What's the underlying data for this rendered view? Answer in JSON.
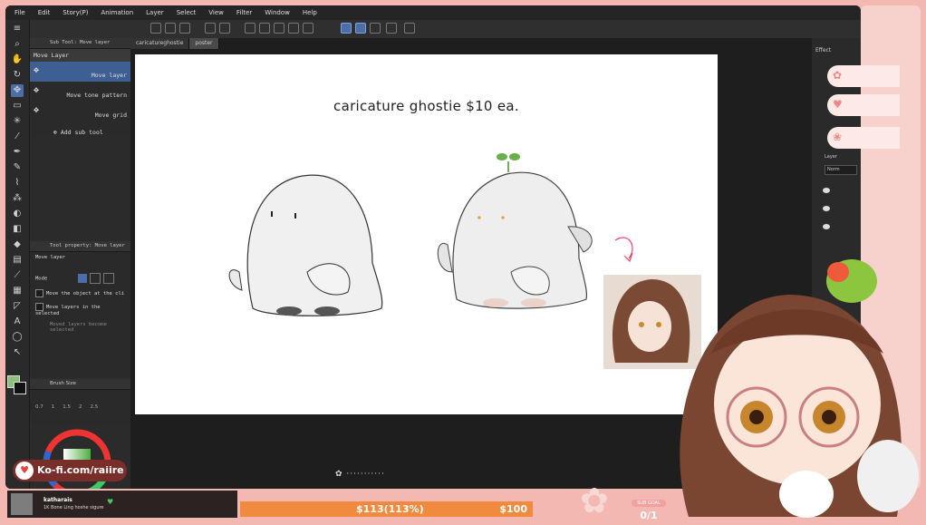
{
  "menu": [
    "File",
    "Edit",
    "Story(P)",
    "Animation",
    "Layer",
    "Select",
    "View",
    "Filter",
    "Window",
    "Help"
  ],
  "tabs": [
    "caricatureghostie",
    "poster"
  ],
  "subtool_panel": {
    "title": "Sub Tool: Move layer",
    "header": "Move Layer",
    "items": [
      {
        "label": "Move layer"
      },
      {
        "label": "Move tone pattern"
      },
      {
        "label": "Move grid"
      }
    ],
    "add": "Add sub tool"
  },
  "tool_property": {
    "title": "Tool property: Move layer",
    "header": "Move layer",
    "mode_label": "Mode",
    "options": [
      "Move the object at the cli",
      "Move layers in the selected",
      "Moved layers become selected"
    ]
  },
  "brush_size": {
    "title": "Brush Size",
    "values": [
      "0.7",
      "1",
      "1.5",
      "2",
      "2.5"
    ]
  },
  "document": {
    "title": "caricature ghostie $10 ea."
  },
  "right_panel": {
    "effect": "Effect",
    "layer": "Layer",
    "blend": "Norm"
  },
  "kofi": {
    "text": "Ko-fi.com/raiire"
  },
  "chat": {
    "name": "katharais",
    "text": "1K Bone Ling hoshe sigure"
  },
  "goal": {
    "current": "$113(113%)",
    "target": "$100",
    "percent": 113
  },
  "sub_goal": {
    "label": "SUB GOAL",
    "value": "0/1"
  },
  "colors": {
    "accent": "#4b6ea8",
    "frame": "#f3b8b2",
    "kofi": "#7a2e2a",
    "goal_fill": "#f08a3e"
  }
}
